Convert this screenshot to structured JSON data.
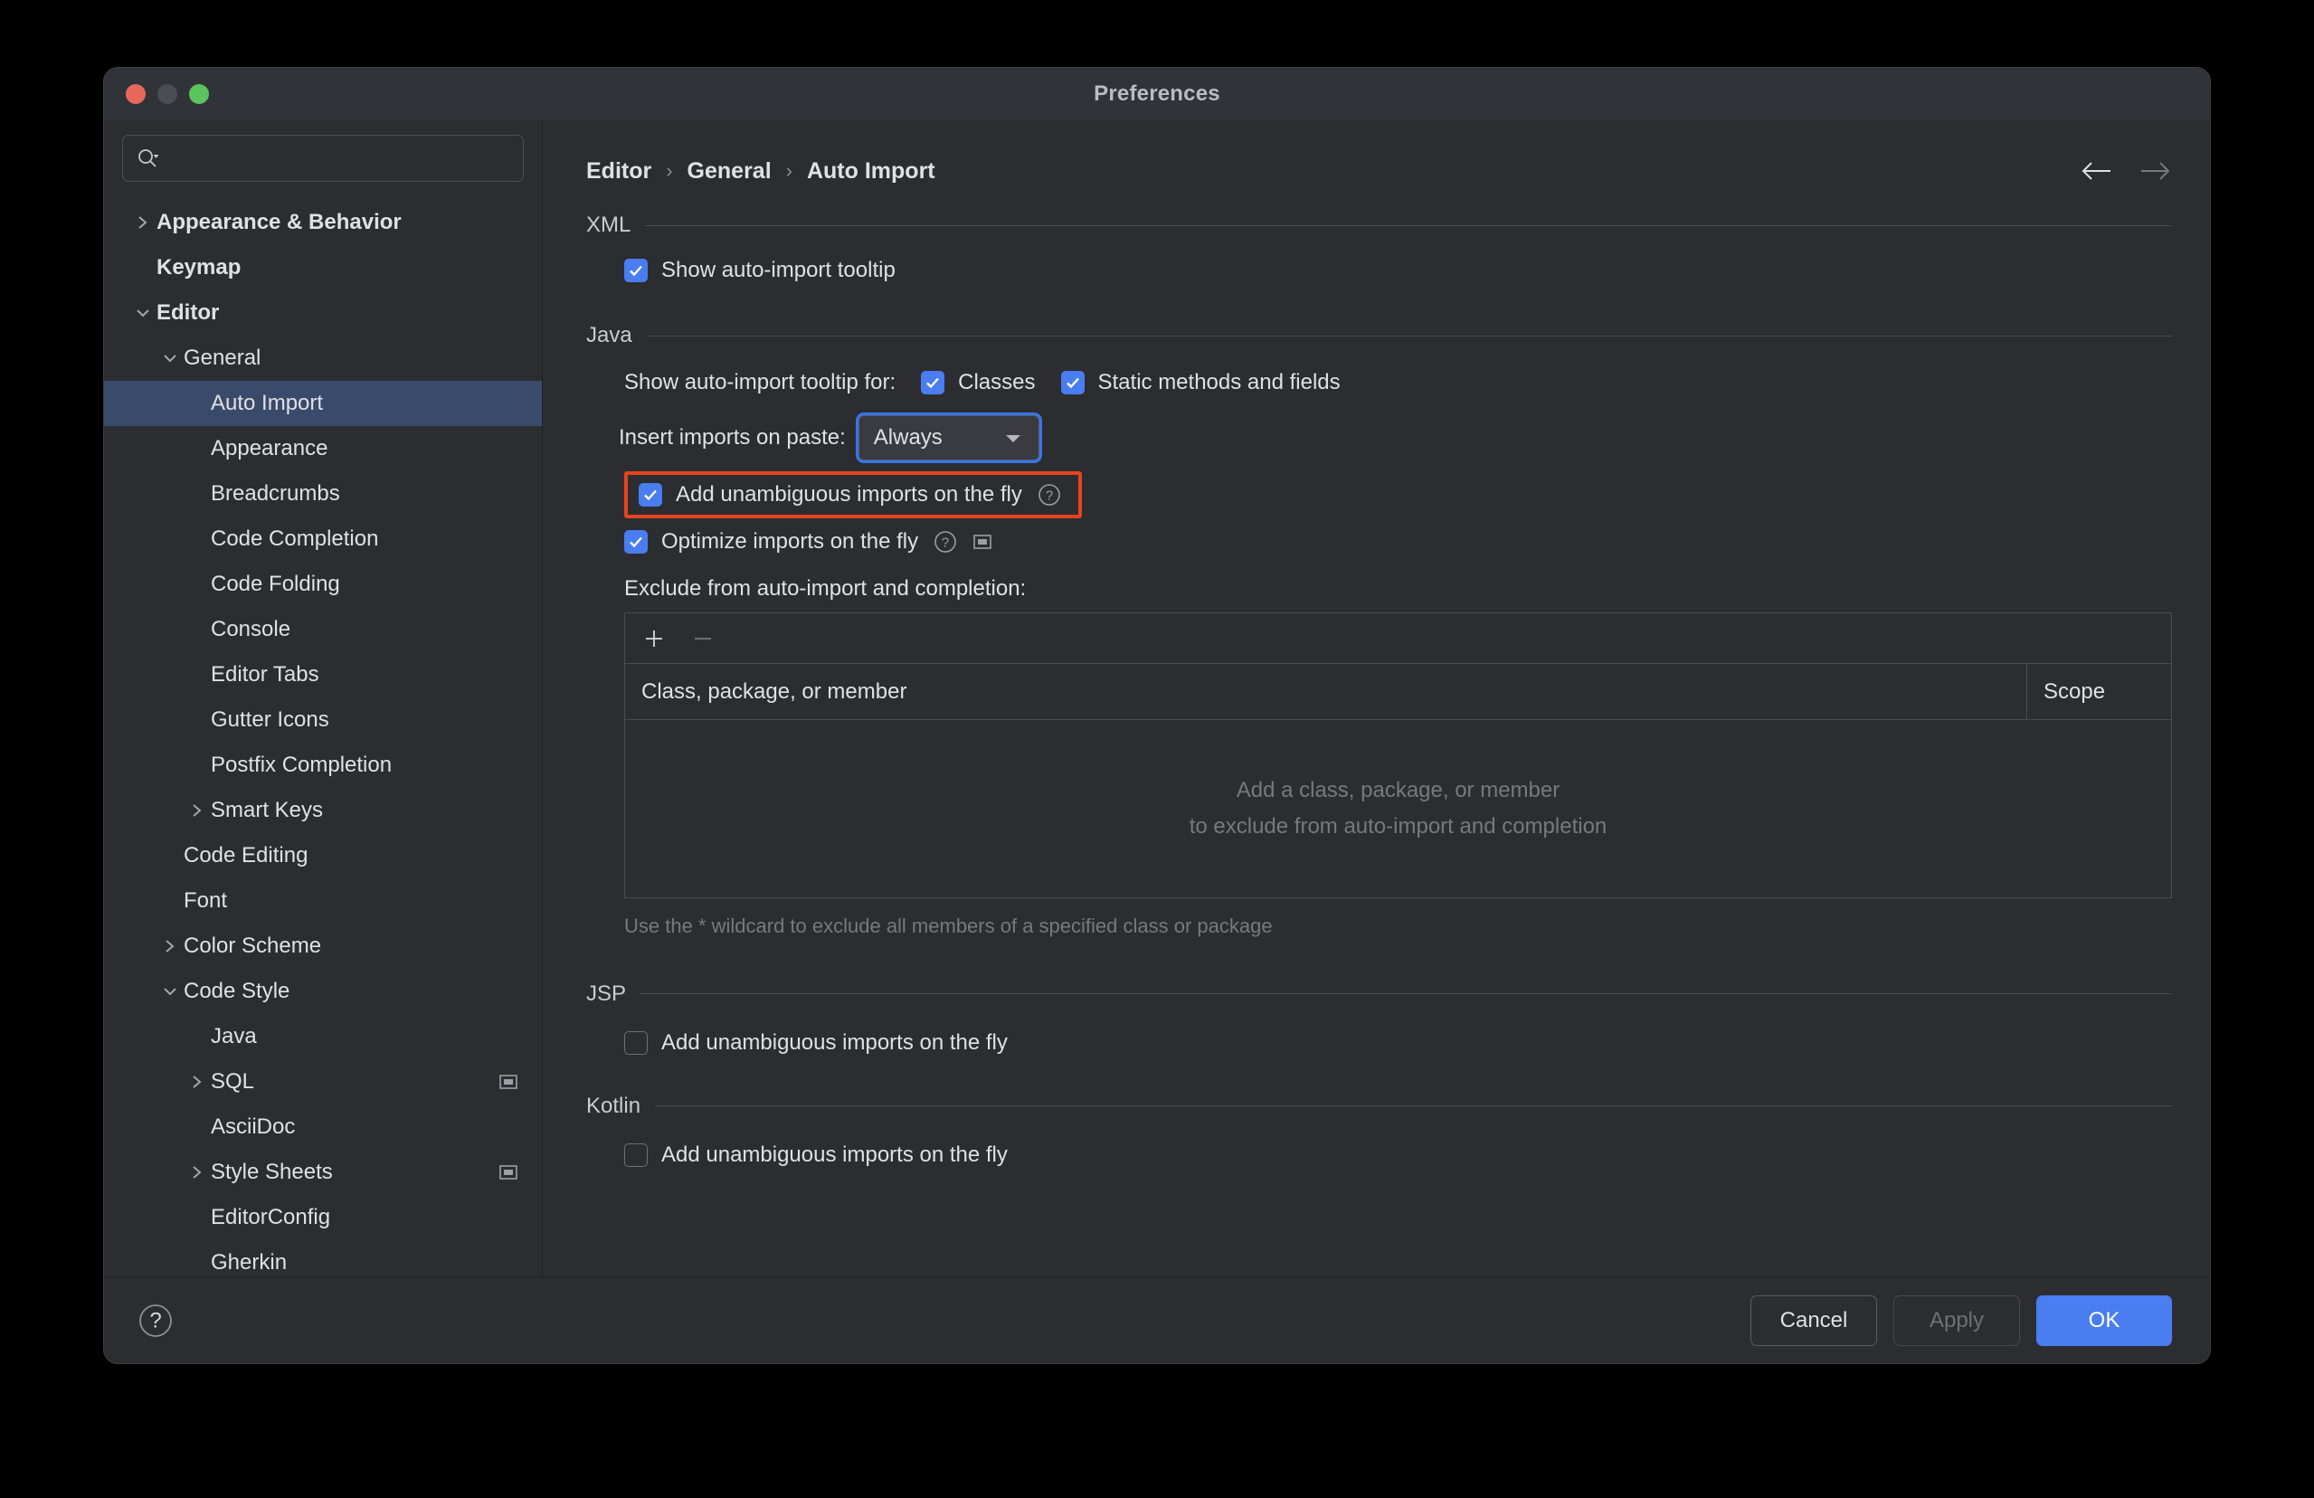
{
  "window": {
    "title": "Preferences",
    "traffic": [
      "close-button",
      "minimize-button",
      "zoom-button"
    ]
  },
  "search": {
    "placeholder": "",
    "value": "",
    "icon": "search-icon"
  },
  "sidebar": {
    "items": [
      {
        "label": "Appearance & Behavior",
        "indent": 0,
        "twisty": "collapsed",
        "bold": true,
        "selected": false,
        "badge": false
      },
      {
        "label": "Keymap",
        "indent": 0,
        "twisty": "none",
        "bold": true,
        "selected": false,
        "badge": false
      },
      {
        "label": "Editor",
        "indent": 0,
        "twisty": "expanded",
        "bold": true,
        "selected": false,
        "badge": false
      },
      {
        "label": "General",
        "indent": 1,
        "twisty": "expanded",
        "bold": false,
        "selected": false,
        "badge": false
      },
      {
        "label": "Auto Import",
        "indent": 2,
        "twisty": "none",
        "bold": false,
        "selected": true,
        "badge": false
      },
      {
        "label": "Appearance",
        "indent": 2,
        "twisty": "none",
        "bold": false,
        "selected": false,
        "badge": false
      },
      {
        "label": "Breadcrumbs",
        "indent": 2,
        "twisty": "none",
        "bold": false,
        "selected": false,
        "badge": false
      },
      {
        "label": "Code Completion",
        "indent": 2,
        "twisty": "none",
        "bold": false,
        "selected": false,
        "badge": false
      },
      {
        "label": "Code Folding",
        "indent": 2,
        "twisty": "none",
        "bold": false,
        "selected": false,
        "badge": false
      },
      {
        "label": "Console",
        "indent": 2,
        "twisty": "none",
        "bold": false,
        "selected": false,
        "badge": false
      },
      {
        "label": "Editor Tabs",
        "indent": 2,
        "twisty": "none",
        "bold": false,
        "selected": false,
        "badge": false
      },
      {
        "label": "Gutter Icons",
        "indent": 2,
        "twisty": "none",
        "bold": false,
        "selected": false,
        "badge": false
      },
      {
        "label": "Postfix Completion",
        "indent": 2,
        "twisty": "none",
        "bold": false,
        "selected": false,
        "badge": false
      },
      {
        "label": "Smart Keys",
        "indent": 2,
        "twisty": "collapsed",
        "bold": false,
        "selected": false,
        "badge": false
      },
      {
        "label": "Code Editing",
        "indent": 1,
        "twisty": "none",
        "bold": false,
        "selected": false,
        "badge": false
      },
      {
        "label": "Font",
        "indent": 1,
        "twisty": "none",
        "bold": false,
        "selected": false,
        "badge": false
      },
      {
        "label": "Color Scheme",
        "indent": 1,
        "twisty": "collapsed",
        "bold": false,
        "selected": false,
        "badge": false
      },
      {
        "label": "Code Style",
        "indent": 1,
        "twisty": "expanded",
        "bold": false,
        "selected": false,
        "badge": false
      },
      {
        "label": "Java",
        "indent": 2,
        "twisty": "none",
        "bold": false,
        "selected": false,
        "badge": false
      },
      {
        "label": "SQL",
        "indent": 2,
        "twisty": "collapsed",
        "bold": false,
        "selected": false,
        "badge": true
      },
      {
        "label": "AsciiDoc",
        "indent": 2,
        "twisty": "none",
        "bold": false,
        "selected": false,
        "badge": false
      },
      {
        "label": "Style Sheets",
        "indent": 2,
        "twisty": "collapsed",
        "bold": false,
        "selected": false,
        "badge": true
      },
      {
        "label": "EditorConfig",
        "indent": 2,
        "twisty": "none",
        "bold": false,
        "selected": false,
        "badge": false
      },
      {
        "label": "Gherkin",
        "indent": 2,
        "twisty": "none",
        "bold": false,
        "selected": false,
        "badge": false
      }
    ]
  },
  "breadcrumb": {
    "items": [
      "Editor",
      "General",
      "Auto Import"
    ],
    "separator": "›",
    "back_icon": "arrow-left-icon",
    "forward_icon": "arrow-right-icon"
  },
  "sections": {
    "xml": {
      "title": "XML",
      "show_tooltip": {
        "label": "Show auto-import tooltip",
        "checked": true
      }
    },
    "java": {
      "title": "Java",
      "tooltip_for_label": "Show auto-import tooltip for:",
      "classes": {
        "label": "Classes",
        "checked": true
      },
      "static_members": {
        "label": "Static methods and fields",
        "checked": true
      },
      "insert_on_paste_label": "Insert imports on paste:",
      "insert_on_paste_value": "Always",
      "add_unambiguous": {
        "label": "Add unambiguous imports on the fly",
        "checked": true,
        "highlighted": true
      },
      "optimize": {
        "label": "Optimize imports on the fly",
        "checked": true
      },
      "exclude_label": "Exclude from auto-import and completion:",
      "table": {
        "add_icon": "plus-icon",
        "remove_icon": "minus-icon",
        "columns": [
          "Class, package, or member",
          "Scope"
        ],
        "rows": [],
        "empty_line_1": "Add a class, package, or member",
        "empty_line_2": "to exclude from auto-import and completion"
      },
      "hint": "Use the * wildcard to exclude all members of a specified class or package"
    },
    "jsp": {
      "title": "JSP",
      "add_unambiguous": {
        "label": "Add unambiguous imports on the fly",
        "checked": false
      }
    },
    "kotlin": {
      "title": "Kotlin",
      "add_unambiguous": {
        "label": "Add unambiguous imports on the fly",
        "checked": false
      }
    }
  },
  "footer": {
    "help_icon": "help-question-icon",
    "cancel": "Cancel",
    "apply": "Apply",
    "ok": "OK"
  },
  "colors": {
    "accent": "#4a7df0",
    "selection": "#3a4a6b",
    "highlight_box": "#e8431f",
    "focus_ring": "#3574f0",
    "window_bg": "#2b2d30",
    "titlebar_bg": "#303338"
  }
}
